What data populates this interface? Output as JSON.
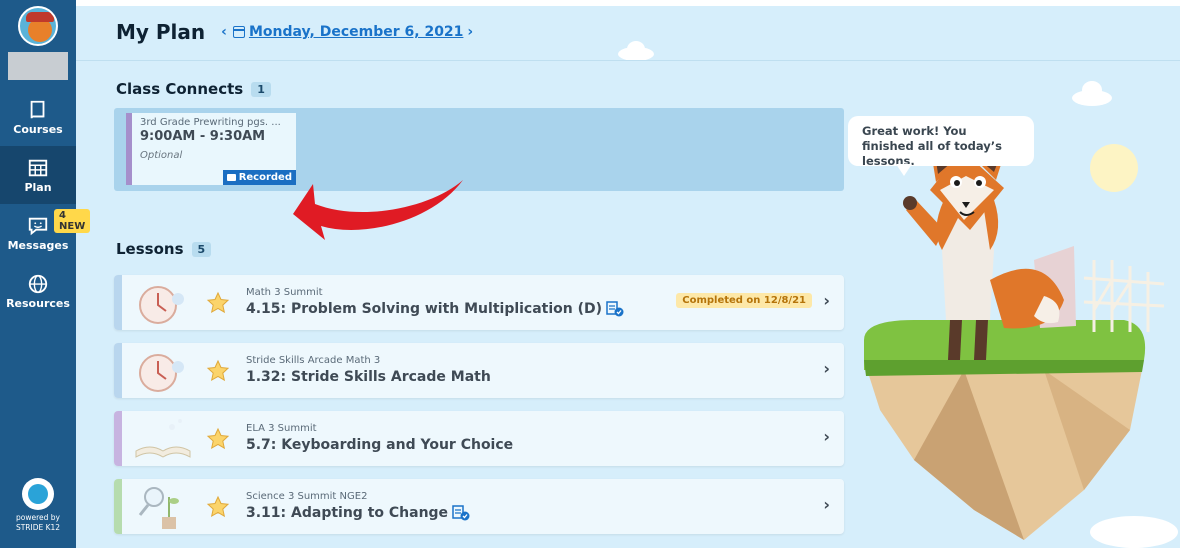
{
  "sidebar": {
    "items": [
      {
        "label": "Courses"
      },
      {
        "label": "Plan"
      },
      {
        "label": "Messages"
      },
      {
        "label": "Resources"
      }
    ],
    "messages_badge": "4 NEW",
    "powered_line1": "powered by",
    "powered_line2": "STRIDE K12"
  },
  "header": {
    "title": "My Plan",
    "prev_arrow": "‹",
    "next_arrow": "›",
    "date": "Monday, December 6, 2021"
  },
  "class_connects": {
    "title": "Class Connects",
    "count": "1",
    "card": {
      "title": "3rd Grade Prewriting pgs. ...",
      "time": "9:00AM - 9:30AM",
      "status": "Optional",
      "button": "Recorded"
    }
  },
  "lessons": {
    "title": "Lessons",
    "count": "5",
    "items": [
      {
        "course": "Math 3 Summit",
        "title": "4.15: Problem Solving with Multiplication (D)",
        "completed": "Completed on 12/8/21"
      },
      {
        "course": "Stride Skills Arcade Math 3",
        "title": "1.32: Stride Skills Arcade Math"
      },
      {
        "course": "ELA 3 Summit",
        "title": "5.7: Keyboarding and Your Choice"
      },
      {
        "course": "Science 3 Summit NGE2",
        "title": "3.11: Adapting to Change"
      }
    ]
  },
  "speech_bubble": "Great work! You finished all of today’s lessons.",
  "colors": {
    "sidebar": "#1e5a8a",
    "accent_blue": "#1a73c9",
    "math_bar": "#b9d6ee",
    "ela_bar": "#c7b3e0",
    "science_bar": "#b6dcae",
    "class_connect_bar": "#a58fcb",
    "red_arrow": "#e01b24"
  }
}
